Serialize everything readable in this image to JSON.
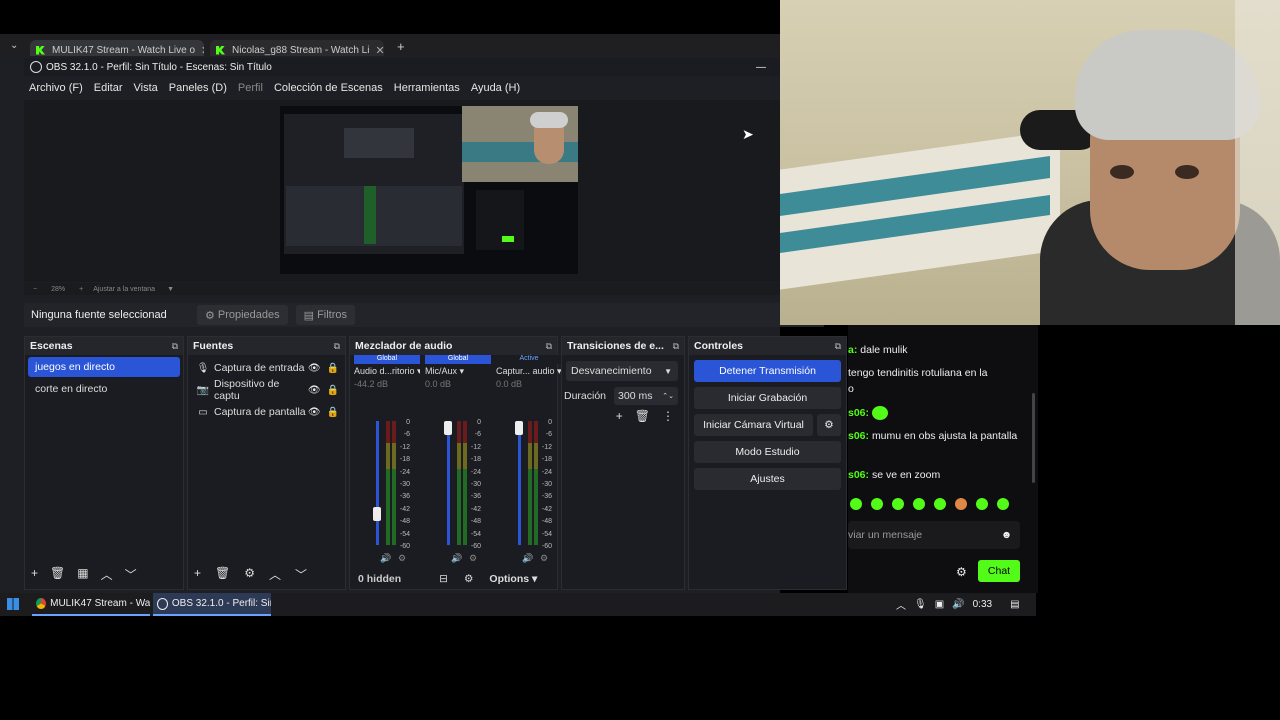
{
  "browser": {
    "tabs": [
      {
        "label": "MULIK47 Stream - Watch Live o"
      },
      {
        "label": "Nicolas_g88 Stream - Watch Li"
      }
    ],
    "new_tab": "+"
  },
  "obs": {
    "title": "OBS 32.1.0 - Perfil: Sin Título - Escenas: Sin Título",
    "menu": [
      "Archivo (F)",
      "Editar",
      "Vista",
      "Paneles (D)",
      "Perfil",
      "Colección de Escenas",
      "Herramientas",
      "Ayuda (H)"
    ],
    "zoom": {
      "level": "28%",
      "fit": "Ajustar a la ventana"
    },
    "no_source": "Ninguna fuente seleccionad",
    "properties": "Propiedades",
    "filters": "Filtros",
    "scenes": {
      "title": "Escenas",
      "items": [
        "juegos en directo",
        "corte en directo"
      ],
      "selected": 0
    },
    "sources": {
      "title": "Fuentes",
      "items": [
        {
          "label": "Captura de entrada",
          "icon": "microphone-icon"
        },
        {
          "label": "Dispositivo de captu",
          "icon": "camera-icon"
        },
        {
          "label": "Captura de pantalla",
          "icon": "monitor-icon"
        }
      ]
    },
    "mixer": {
      "title": "Mezclador de audio",
      "channels": [
        {
          "badge": "Global",
          "name": "Audio d...ritorio",
          "db": "-44.2 dB",
          "level": 0.22
        },
        {
          "badge": "Global",
          "name": "Mic/Aux",
          "db": "0.0 dB",
          "level": 1.0
        },
        {
          "badge": "Active",
          "name": "Captur... audio",
          "db": "0.0 dB",
          "level": 1.0
        }
      ],
      "scale": [
        "0",
        "-6",
        "-12",
        "-18",
        "-24",
        "-30",
        "-36",
        "-42",
        "-48",
        "-54",
        "-60"
      ],
      "hidden": "0 hidden",
      "options": "Options"
    },
    "transitions": {
      "title": "Transiciones de e...",
      "type": "Desvanecimiento",
      "duration_label": "Duración",
      "duration": "300 ms"
    },
    "controls": {
      "title": "Controles",
      "stream": "Detener Transmisión",
      "record": "Iniciar Grabación",
      "vcam": "Iniciar Cámara Virtual",
      "studio": "Modo Estudio",
      "settings": "Ajustes"
    }
  },
  "chat": {
    "messages": [
      {
        "user": "a:",
        "text": "dale mulik"
      },
      {
        "user": "",
        "text": "tengo tendinitis rotuliana en la"
      },
      {
        "user": "",
        "text": "o"
      },
      {
        "user": "s06:",
        "text": ""
      },
      {
        "user": "s06:",
        "text": "mumu en obs ajusta la pantalla"
      },
      {
        "user": "s06:",
        "text": "se ve en zoom"
      }
    ],
    "placeholder": "viar un mensaje",
    "send": "Chat"
  },
  "taskbar": {
    "apps": [
      "MULIK47 Stream - Wa...",
      "OBS 32.1.0 - Perfil: Sin..."
    ],
    "time": "0:33"
  },
  "colors": {
    "kick_green": "#53fc18",
    "obs_blue": "#2a55d6"
  }
}
